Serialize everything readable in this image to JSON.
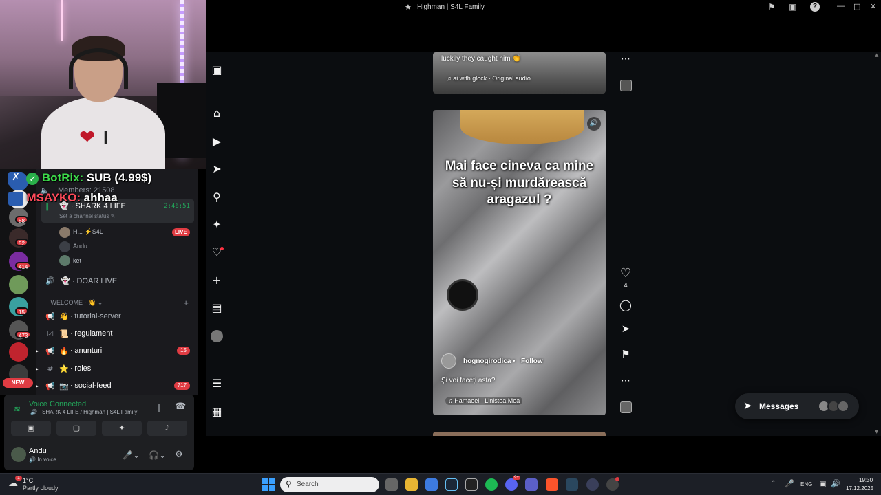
{
  "window": {
    "title": "Highman | S4L Family"
  },
  "chat_overlay": [
    {
      "user": "BotRix:",
      "message": "SUB (4.99$)",
      "color": "#3ddc4b"
    },
    {
      "user": "MSAYKO:",
      "message": "ahhaa",
      "color": "#ff4a5a"
    }
  ],
  "discord": {
    "server_badges": [
      "88",
      "52",
      "414",
      "15",
      "473"
    ],
    "new_badge": "NEW",
    "members_label": "Members: 21508",
    "channels": [
      {
        "name": "SHARK 4 LIFE",
        "time": "2:46:51",
        "status": "Set a channel status"
      },
      {
        "name": "Andu"
      },
      {
        "name": "ket"
      },
      {
        "name": "· DOAR LIVE"
      }
    ],
    "stream_user_tag": "S4L",
    "live_badge": "LIVE",
    "category": "WELCOME -",
    "text_channels": [
      {
        "name": "· tutorial-server",
        "emoji": "👋"
      },
      {
        "name": "· regulament",
        "emoji": "📜"
      },
      {
        "name": "· anunturi",
        "emoji": "🔥",
        "badge": "15"
      },
      {
        "name": "· roles",
        "emoji": "⭐"
      },
      {
        "name": "· social-feed",
        "emoji": "📷",
        "badge": "717"
      }
    ],
    "voice": {
      "status": "Voice Connected",
      "location": "SHARK 4 LIFE / Highman | S4L Family"
    },
    "user": {
      "name": "Andu",
      "status": "In voice"
    }
  },
  "instagram": {
    "reel_top": {
      "caption": "luckily they caught him 👏",
      "audio": "ai.with.glock · Original audio"
    },
    "reel_main": {
      "overlay_text": [
        "Mai face cineva ca mine",
        "să nu-și murdărească",
        "aragazul ?"
      ],
      "username": "hognogirodica",
      "follow": "Follow",
      "caption": "Și voi faceți asta?",
      "audio": "Hamaeel · Liniștea Mea",
      "likes": "4"
    },
    "messages_label": "Messages"
  },
  "taskbar": {
    "weather_temp": "1°C",
    "weather_desc": "Partly cloudy",
    "weather_badge": "1",
    "search_placeholder": "Search",
    "language": "ENG",
    "time": "19:30",
    "date": "17.12.2025",
    "discord_badge": "9+"
  }
}
